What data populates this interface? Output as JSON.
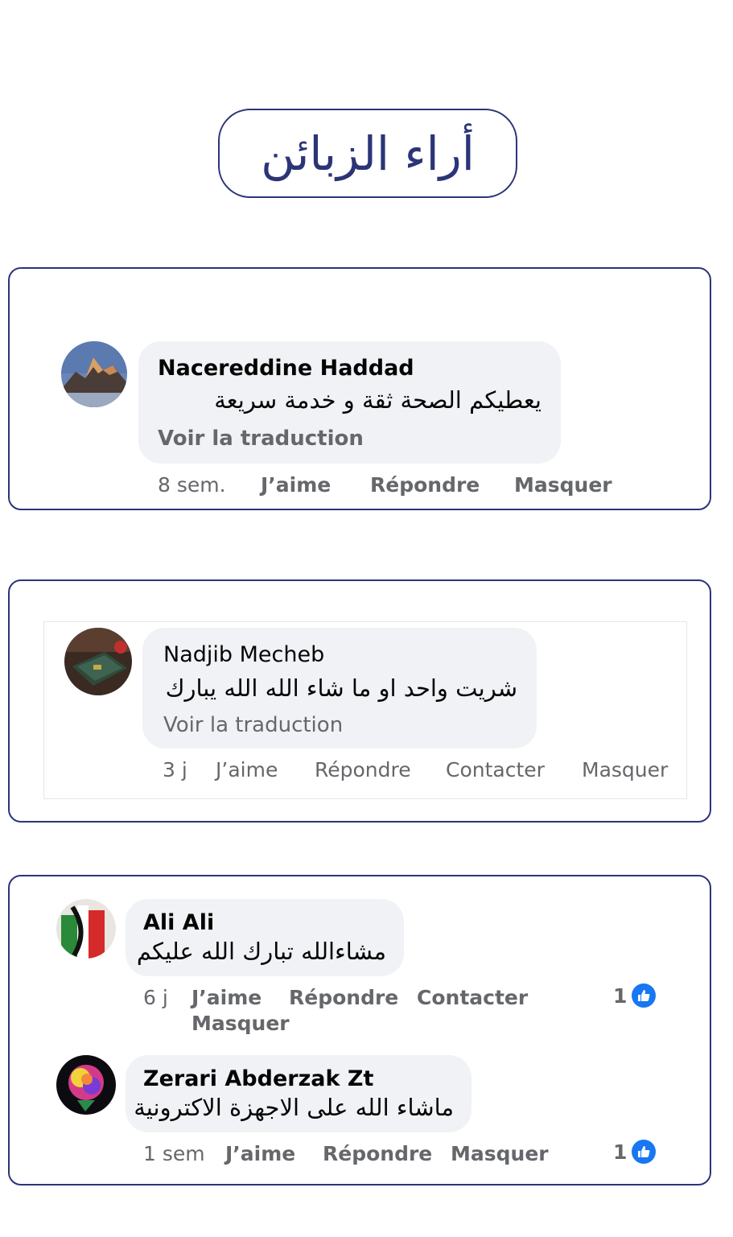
{
  "page_title": "أراء الزبائن",
  "colors": {
    "frame": "#2b3576",
    "bubble": "#f0f2f5",
    "meta": "#65676b",
    "like": "#1877f2"
  },
  "comments": [
    {
      "name": "Nacereddine Haddad",
      "text": "يعطيكم الصحة ثقة و خدمة سريعة",
      "translate": "Voir la traduction",
      "time": "8 sem.",
      "actions": [
        "J’aime",
        "Répondre",
        "Masquer"
      ]
    },
    {
      "name": "Nadjib Mecheb",
      "text": "شريت واحد او ما شاء الله  الله يبارك",
      "translate": "Voir la traduction",
      "time": "3 j",
      "actions": [
        "J’aime",
        "Répondre",
        "Contacter",
        "Masquer"
      ]
    },
    {
      "name": "Ali Ali",
      "text": "مشاءالله تبارك الله عليكم",
      "time": "6 j",
      "actions": [
        "J’aime",
        "Répondre",
        "Contacter",
        "Masquer"
      ],
      "likes": "1"
    },
    {
      "name": "Zerari Abderzak Zt",
      "text": "ماشاء الله على الاجهزة الاكترونية",
      "time": "1 sem",
      "actions": [
        "J’aime",
        "Répondre",
        "Masquer"
      ],
      "likes": "1"
    }
  ],
  "icons": {
    "avatar": "profile-photo",
    "like": "thumbs-up-icon"
  }
}
